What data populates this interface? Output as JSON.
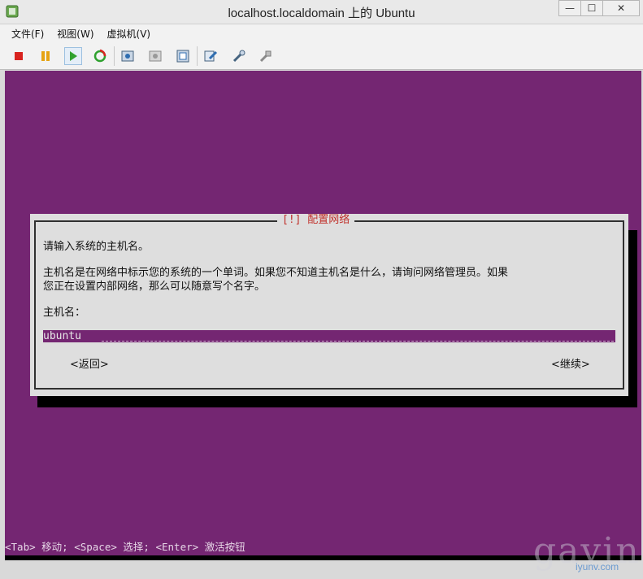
{
  "window": {
    "title": "localhost.localdomain 上的 Ubuntu",
    "buttons": {
      "minimize": "—",
      "maximize": "☐",
      "close": "✕"
    }
  },
  "menu": [
    "文件(F)",
    "视图(W)",
    "虚拟机(V)"
  ],
  "toolbar": {
    "icons": [
      "stop-icon",
      "pause-icon",
      "play-icon",
      "refresh-icon",
      "snapshot-icon",
      "snapshot-revert-icon",
      "snapshot-manager-icon",
      "settings-icon",
      "tools-icon",
      "connect-icon"
    ]
  },
  "dialog": {
    "title": "[!] 配置网络",
    "prompt": "请输入系统的主机名。",
    "description_line1": "主机名是在网络中标示您的系统的一个单词。如果您不知道主机名是什么，请询问网络管理员。如果",
    "description_line2": "您正在设置内部网络，那么可以随意写个名字。",
    "field_label": "主机名：",
    "hostname_value": "ubuntu",
    "back_button": "<返回>",
    "continue_button": "<继续>"
  },
  "status_line": "<Tab> 移动; <Space> 选择; <Enter> 激活按钮",
  "watermark": {
    "text": "gavin",
    "sub": "iyunv.com"
  },
  "colors": {
    "console_bg": "#742672",
    "dialog_bg": "#dedede",
    "title_red": "#c0302a"
  }
}
